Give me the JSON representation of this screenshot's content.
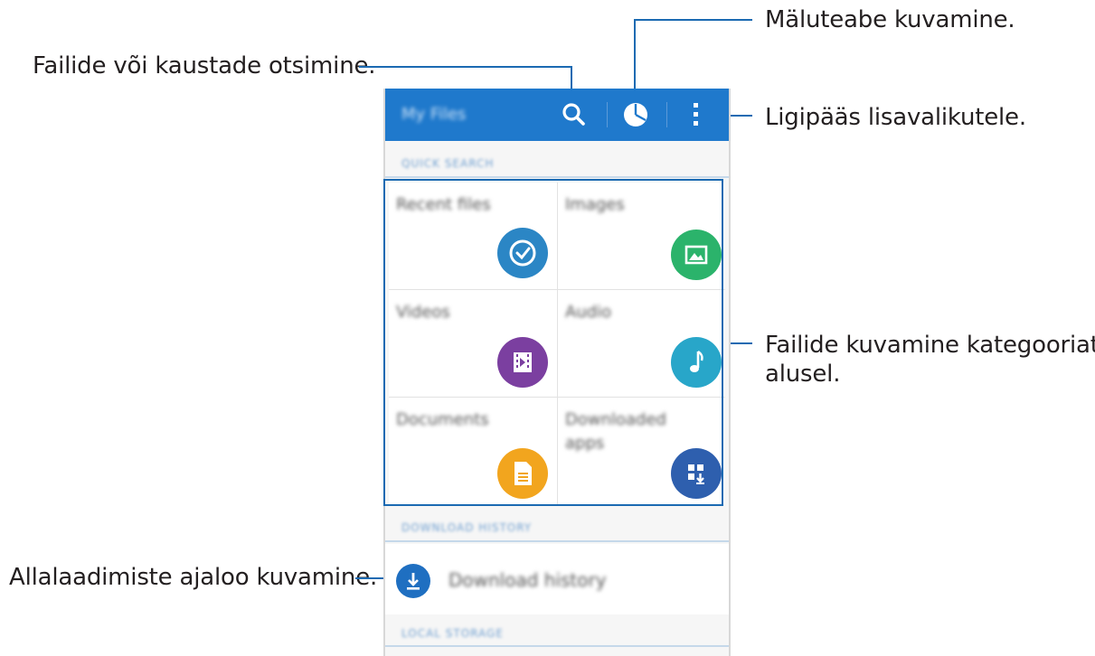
{
  "callouts": {
    "search": "Failide või kaustade otsimine.",
    "storage": "Mäluteabe kuvamine.",
    "more": "Ligipääs lisavalikutele.",
    "categories_line1": "Failide kuvamine kategooriate",
    "categories_line2": "alusel.",
    "download_history": "Allalaadimiste ajaloo kuvamine."
  },
  "appbar": {
    "title": "My Files",
    "search_icon": "search-icon",
    "storage_icon": "pie-chart-icon",
    "more_icon": "more-vert-icon",
    "color": "#1f79cc"
  },
  "sections": {
    "quick_search": "QUICK SEARCH",
    "download_history": "DOWNLOAD HISTORY",
    "local_storage": "LOCAL STORAGE"
  },
  "categories": [
    {
      "label": "Recent files",
      "icon": "clock-icon",
      "color": "#2b86c5"
    },
    {
      "label": "Images",
      "icon": "image-icon",
      "color": "#2bb36b"
    },
    {
      "label": "Videos",
      "icon": "film-icon",
      "color": "#7b3fa0"
    },
    {
      "label": "Audio",
      "icon": "music-note-icon",
      "color": "#28a6c9"
    },
    {
      "label": "Documents",
      "icon": "document-icon",
      "color": "#f2a51e"
    },
    {
      "label": "Downloaded apps",
      "icon": "apps-download-icon",
      "color": "#2e5fae"
    }
  ],
  "download_item": {
    "label": "Download history",
    "icon": "download-icon"
  }
}
